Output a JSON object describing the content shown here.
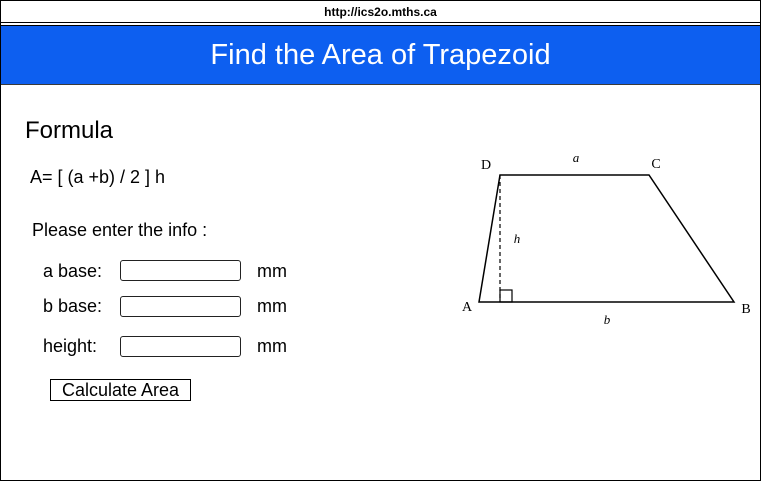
{
  "browser": {
    "url": "http://ics2o.mths.ca"
  },
  "header": {
    "title": "Find the Area of Trapezoid",
    "background_color": "#0d5ff0",
    "text_color": "#ffffff"
  },
  "main": {
    "formula_heading": "Formula",
    "formula": "A= [ (a +b) / 2 ] h",
    "instruction": "Please enter the info :",
    "fields": [
      {
        "label": "a base:",
        "value": "",
        "unit": "mm"
      },
      {
        "label": "b base:",
        "value": "",
        "unit": "mm"
      },
      {
        "label": "height:",
        "value": "",
        "unit": "mm"
      }
    ],
    "calculate_button": "Calculate Area"
  },
  "diagram": {
    "vertex_labels": {
      "A": "A",
      "B": "B",
      "C": "C",
      "D": "D"
    },
    "edge_labels": {
      "top": "a",
      "bottom": "b",
      "height": "h"
    }
  }
}
